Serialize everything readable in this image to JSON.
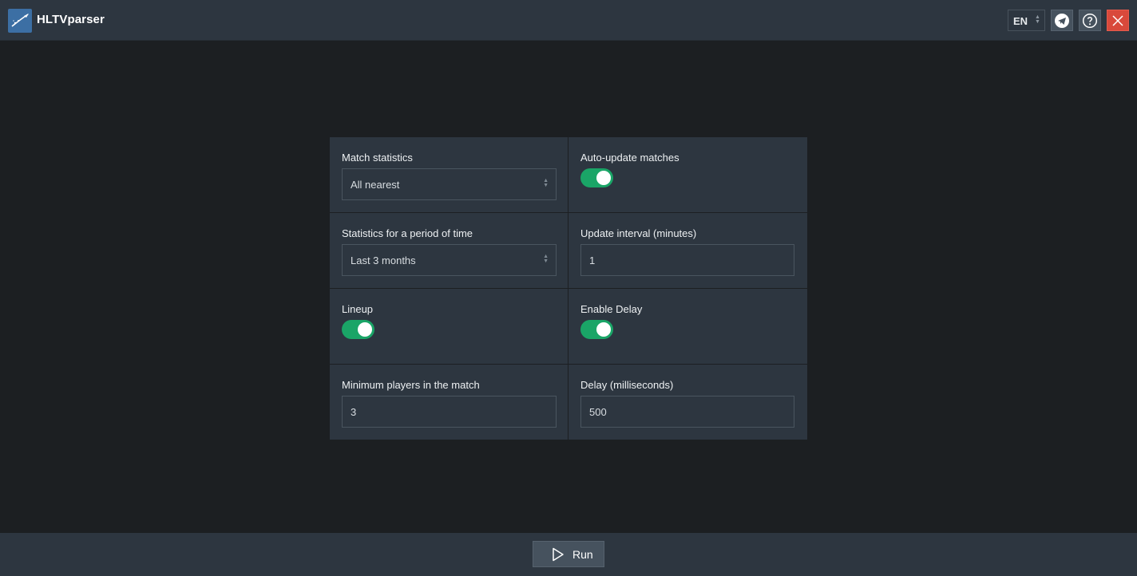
{
  "app": {
    "title": "HLTVparser"
  },
  "titlebar": {
    "language": "EN",
    "icons": {
      "logo": "hltv-logo-icon",
      "telegram": "telegram-icon",
      "help": "help-icon",
      "close": "close-icon"
    },
    "colors": {
      "close_bg": "#d9493b"
    }
  },
  "settings": {
    "match_statistics": {
      "label": "Match statistics",
      "value": "All nearest"
    },
    "auto_update": {
      "label": "Auto-update matches",
      "enabled": true
    },
    "period": {
      "label": "Statistics for a period of time",
      "value": "Last 3 months"
    },
    "update_interval": {
      "label": "Update interval (minutes)",
      "value": "1"
    },
    "lineup": {
      "label": "Lineup",
      "enabled": true
    },
    "enable_delay": {
      "label": "Enable Delay",
      "enabled": true
    },
    "min_players": {
      "label": "Minimum players in the match",
      "value": "3"
    },
    "delay": {
      "label": "Delay (milliseconds)",
      "value": "500"
    }
  },
  "footer": {
    "run_label": "Run",
    "run_icon": "play-icon"
  },
  "colors": {
    "toggle_on": "#1aa567",
    "background": "#1c1f22",
    "panel": "#2d3640"
  }
}
